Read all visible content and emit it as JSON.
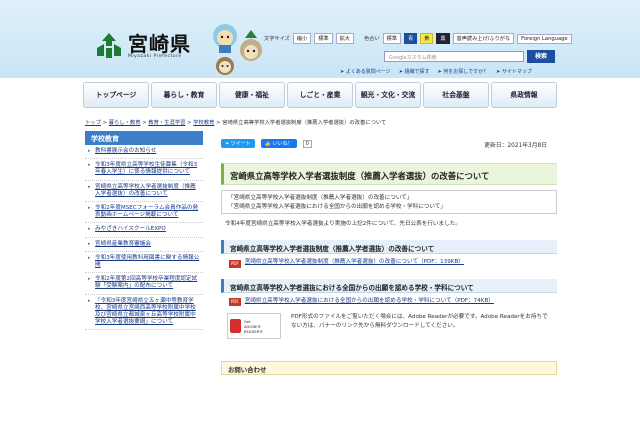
{
  "header": {
    "logo_title": "宮崎県",
    "logo_sub": "Miyazaki Prefecture",
    "toolbar": {
      "font_size_label": "文字サイズ",
      "shrink": "縮小",
      "standard1": "標準",
      "enlarge": "拡大",
      "color_label": "色合い",
      "standard2": "標準",
      "c1": "青",
      "c2": "黄",
      "c3": "黒",
      "voice": "音声読み上げ/ふりがな",
      "foreign": "Foreign Language"
    },
    "search": {
      "placeholder": "Googleカスタム検索",
      "button": "検索"
    },
    "sublinks": [
      "よくある質問ページ",
      "組織で探す",
      "何をお探しですか？",
      "サイトマップ"
    ]
  },
  "gnav": [
    "トップページ",
    "暮らし・教育",
    "健康・福祉",
    "しごと・産業",
    "観光・文化・交流",
    "社会基盤",
    "県政情報"
  ],
  "breadcrumbs": {
    "items": [
      "トップ",
      "暮らし・教育",
      "教育・生涯学習",
      "学校教育"
    ],
    "sep": " > ",
    "current": "宮崎県立高等学校入学者選抜制度（推薦入学者選抜）の改善について"
  },
  "sidebar": {
    "title": "学校教育",
    "items": [
      "教科書展示会のお知らせ",
      "令和3年度県立高等学校生徒募集（令和3年春入学生）に係る情報提供について",
      "宮崎県立高等学校入学者選抜制度（推薦入学者選抜）の改善について",
      "令和2年度MSECフォーラム会員作品の発表動画ホームページ掲載について",
      "みやざきハイスクールEXPO",
      "宮崎県産業教育審議会",
      "令和3年度使用教科用図書に関する情報公開",
      "令和2年度第2回高等学校卒業程度認定試験「受験案内」の配布について",
      "「令和3年度宮崎県立五ヶ瀬中等教育学校、宮崎県立宮崎西高等学校附属中学校及び宮崎県立都城泉ヶ丘高等学校附属中学校入学者選抜要綱」について"
    ]
  },
  "main": {
    "tweet": "ツイート",
    "like": "いいね！",
    "like_count": "0",
    "updated": "更新日：2021年3月8日",
    "title": "宮崎県立高等学校入学者選抜制度（推薦入学者選抜）の改善について",
    "list": [
      "「宮崎県立高等学校入学者選抜制度（推薦入学者選抜）の改善について」",
      "「宮崎県立高等学校入学者選抜における全国からの出願を認める学校・学科について」"
    ],
    "intro": "令和4年度宮崎県立高等学校入学者選抜より実施の上記2件について、先日公表を行いました。",
    "section1": "宮崎県立高等学校入学者選抜制度（推薦入学者選抜）の改善について",
    "pdf_badge": "PDF",
    "pdf1": "宮崎県立高等学校入学者選抜制度（推薦入学者選抜）の改善について（PDF：139KB）",
    "section2": "宮崎県立高等学校入学者選抜における全国からの出願を認める学校・学科について",
    "pdf2": "宮崎県立高等学校入学者選抜における全国からの出願を認める学校・学科について（PDF：74KB）",
    "reader_badge_line1": "Get",
    "reader_badge_line2": "ADOBE® READER®",
    "reader_note": "PDF形式のファイルをご覧いただく場合には、Adobe Readerが必要です。Adobe Readerをお持ちでない方は、バナーのリンク先から無料ダウンロードしてください。",
    "contact": "お問い合わせ"
  }
}
